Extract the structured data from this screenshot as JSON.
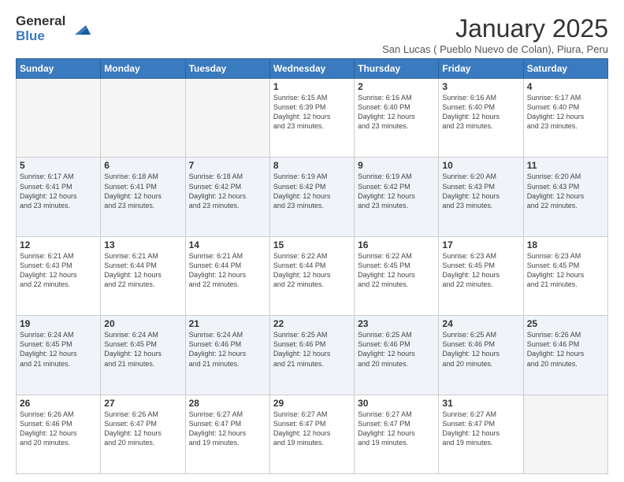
{
  "logo": {
    "general": "General",
    "blue": "Blue"
  },
  "title": "January 2025",
  "subtitle": "San Lucas ( Pueblo Nuevo de Colan), Piura, Peru",
  "days_of_week": [
    "Sunday",
    "Monday",
    "Tuesday",
    "Wednesday",
    "Thursday",
    "Friday",
    "Saturday"
  ],
  "weeks": [
    [
      {
        "day": "",
        "info": ""
      },
      {
        "day": "",
        "info": ""
      },
      {
        "day": "",
        "info": ""
      },
      {
        "day": "1",
        "info": "Sunrise: 6:15 AM\nSunset: 6:39 PM\nDaylight: 12 hours\nand 23 minutes."
      },
      {
        "day": "2",
        "info": "Sunrise: 6:16 AM\nSunset: 6:40 PM\nDaylight: 12 hours\nand 23 minutes."
      },
      {
        "day": "3",
        "info": "Sunrise: 6:16 AM\nSunset: 6:40 PM\nDaylight: 12 hours\nand 23 minutes."
      },
      {
        "day": "4",
        "info": "Sunrise: 6:17 AM\nSunset: 6:40 PM\nDaylight: 12 hours\nand 23 minutes."
      }
    ],
    [
      {
        "day": "5",
        "info": "Sunrise: 6:17 AM\nSunset: 6:41 PM\nDaylight: 12 hours\nand 23 minutes."
      },
      {
        "day": "6",
        "info": "Sunrise: 6:18 AM\nSunset: 6:41 PM\nDaylight: 12 hours\nand 23 minutes."
      },
      {
        "day": "7",
        "info": "Sunrise: 6:18 AM\nSunset: 6:42 PM\nDaylight: 12 hours\nand 23 minutes."
      },
      {
        "day": "8",
        "info": "Sunrise: 6:19 AM\nSunset: 6:42 PM\nDaylight: 12 hours\nand 23 minutes."
      },
      {
        "day": "9",
        "info": "Sunrise: 6:19 AM\nSunset: 6:42 PM\nDaylight: 12 hours\nand 23 minutes."
      },
      {
        "day": "10",
        "info": "Sunrise: 6:20 AM\nSunset: 6:43 PM\nDaylight: 12 hours\nand 23 minutes."
      },
      {
        "day": "11",
        "info": "Sunrise: 6:20 AM\nSunset: 6:43 PM\nDaylight: 12 hours\nand 22 minutes."
      }
    ],
    [
      {
        "day": "12",
        "info": "Sunrise: 6:21 AM\nSunset: 6:43 PM\nDaylight: 12 hours\nand 22 minutes."
      },
      {
        "day": "13",
        "info": "Sunrise: 6:21 AM\nSunset: 6:44 PM\nDaylight: 12 hours\nand 22 minutes."
      },
      {
        "day": "14",
        "info": "Sunrise: 6:21 AM\nSunset: 6:44 PM\nDaylight: 12 hours\nand 22 minutes."
      },
      {
        "day": "15",
        "info": "Sunrise: 6:22 AM\nSunset: 6:44 PM\nDaylight: 12 hours\nand 22 minutes."
      },
      {
        "day": "16",
        "info": "Sunrise: 6:22 AM\nSunset: 6:45 PM\nDaylight: 12 hours\nand 22 minutes."
      },
      {
        "day": "17",
        "info": "Sunrise: 6:23 AM\nSunset: 6:45 PM\nDaylight: 12 hours\nand 22 minutes."
      },
      {
        "day": "18",
        "info": "Sunrise: 6:23 AM\nSunset: 6:45 PM\nDaylight: 12 hours\nand 21 minutes."
      }
    ],
    [
      {
        "day": "19",
        "info": "Sunrise: 6:24 AM\nSunset: 6:45 PM\nDaylight: 12 hours\nand 21 minutes."
      },
      {
        "day": "20",
        "info": "Sunrise: 6:24 AM\nSunset: 6:45 PM\nDaylight: 12 hours\nand 21 minutes."
      },
      {
        "day": "21",
        "info": "Sunrise: 6:24 AM\nSunset: 6:46 PM\nDaylight: 12 hours\nand 21 minutes."
      },
      {
        "day": "22",
        "info": "Sunrise: 6:25 AM\nSunset: 6:46 PM\nDaylight: 12 hours\nand 21 minutes."
      },
      {
        "day": "23",
        "info": "Sunrise: 6:25 AM\nSunset: 6:46 PM\nDaylight: 12 hours\nand 20 minutes."
      },
      {
        "day": "24",
        "info": "Sunrise: 6:25 AM\nSunset: 6:46 PM\nDaylight: 12 hours\nand 20 minutes."
      },
      {
        "day": "25",
        "info": "Sunrise: 6:26 AM\nSunset: 6:46 PM\nDaylight: 12 hours\nand 20 minutes."
      }
    ],
    [
      {
        "day": "26",
        "info": "Sunrise: 6:26 AM\nSunset: 6:46 PM\nDaylight: 12 hours\nand 20 minutes."
      },
      {
        "day": "27",
        "info": "Sunrise: 6:26 AM\nSunset: 6:47 PM\nDaylight: 12 hours\nand 20 minutes."
      },
      {
        "day": "28",
        "info": "Sunrise: 6:27 AM\nSunset: 6:47 PM\nDaylight: 12 hours\nand 19 minutes."
      },
      {
        "day": "29",
        "info": "Sunrise: 6:27 AM\nSunset: 6:47 PM\nDaylight: 12 hours\nand 19 minutes."
      },
      {
        "day": "30",
        "info": "Sunrise: 6:27 AM\nSunset: 6:47 PM\nDaylight: 12 hours\nand 19 minutes."
      },
      {
        "day": "31",
        "info": "Sunrise: 6:27 AM\nSunset: 6:47 PM\nDaylight: 12 hours\nand 19 minutes."
      },
      {
        "day": "",
        "info": ""
      }
    ]
  ]
}
